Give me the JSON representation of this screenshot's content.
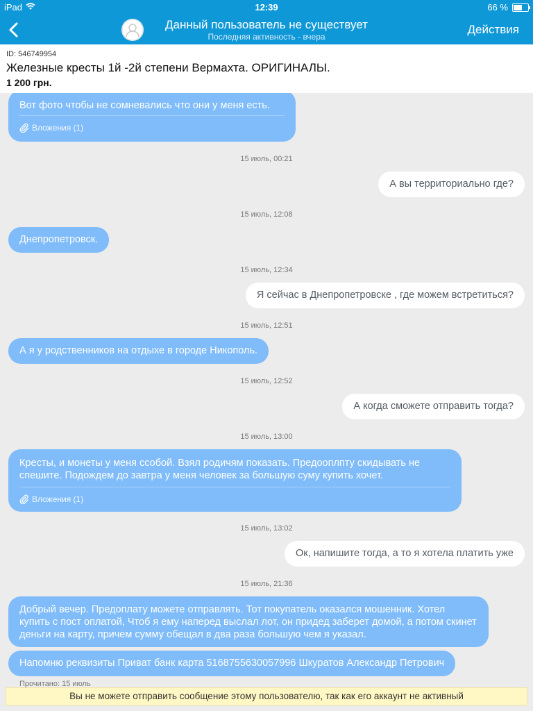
{
  "status_bar": {
    "device": "iPad",
    "time": "12:39",
    "battery": "66 %",
    "battery_level": 0.66
  },
  "nav": {
    "title": "Данный пользователь не существует",
    "subtitle": "Последняя активность - вчера",
    "actions_label": "Действия"
  },
  "listing": {
    "id": "ID: 546749954",
    "title": "Железные кресты 1й -2й степени Вермахта. ОРИГИНАЛЫ.",
    "price": "1 200 грн."
  },
  "chat": {
    "messages": [
      {
        "text": "Вот фото чтобы не сомневались что они у меня есть.",
        "attachment": "Вложения (1)"
      },
      {
        "text": "А вы территориально где?"
      },
      {
        "text": "Днепропетровск."
      },
      {
        "text": "Я сейчас в Днепропетровске , где можем встретиться?"
      },
      {
        "text": "А я у родственников на отдыхе в городе Никополь."
      },
      {
        "text": "А когда сможете отправить тогда?"
      },
      {
        "text": "Кресты, и монеты у меня ссобой. Взял родичям показать. Предооплпту скидывать не спешите. Подождем до завтра у меня человек за большую суму купить хочет.",
        "attachment": "Вложения (1)"
      },
      {
        "text": "Ок, напишите тогда, а то я хотела платить уже"
      },
      {
        "text": "Добрый вечер. Предоплату можете отправлять. Тот покупатель оказался мошенник. Хотел купить с пост оплатой, Чтоб я ему наперед выслал лот, он придед заберет домой, а потом скинет деньги на карту, причем сумму обещал в два раза большую чем я указал."
      },
      {
        "text": "Напомню реквизиты Приват банк карта 5168755630057996 Шкуратов Александр Петрович"
      }
    ],
    "timestamps": [
      "15 июль, 00:21",
      "15 июль, 12:08",
      "15 июль, 12:34",
      "15 июль, 12:51",
      "15 июль, 12:52",
      "15 июль, 13:00",
      "15 июль, 13:02",
      "15 июль, 21:36"
    ],
    "footer_partial": "Прочитано: 15 июль"
  },
  "banner": {
    "text": "Вы не можете отправить сообщение этому пользователю, так как его аккаунт не активный"
  },
  "colors": {
    "header": "#0f98d8",
    "incoming_bubble": "#7fbcf9",
    "outgoing_bubble": "#ffffff",
    "banner": "#fff7c4"
  }
}
